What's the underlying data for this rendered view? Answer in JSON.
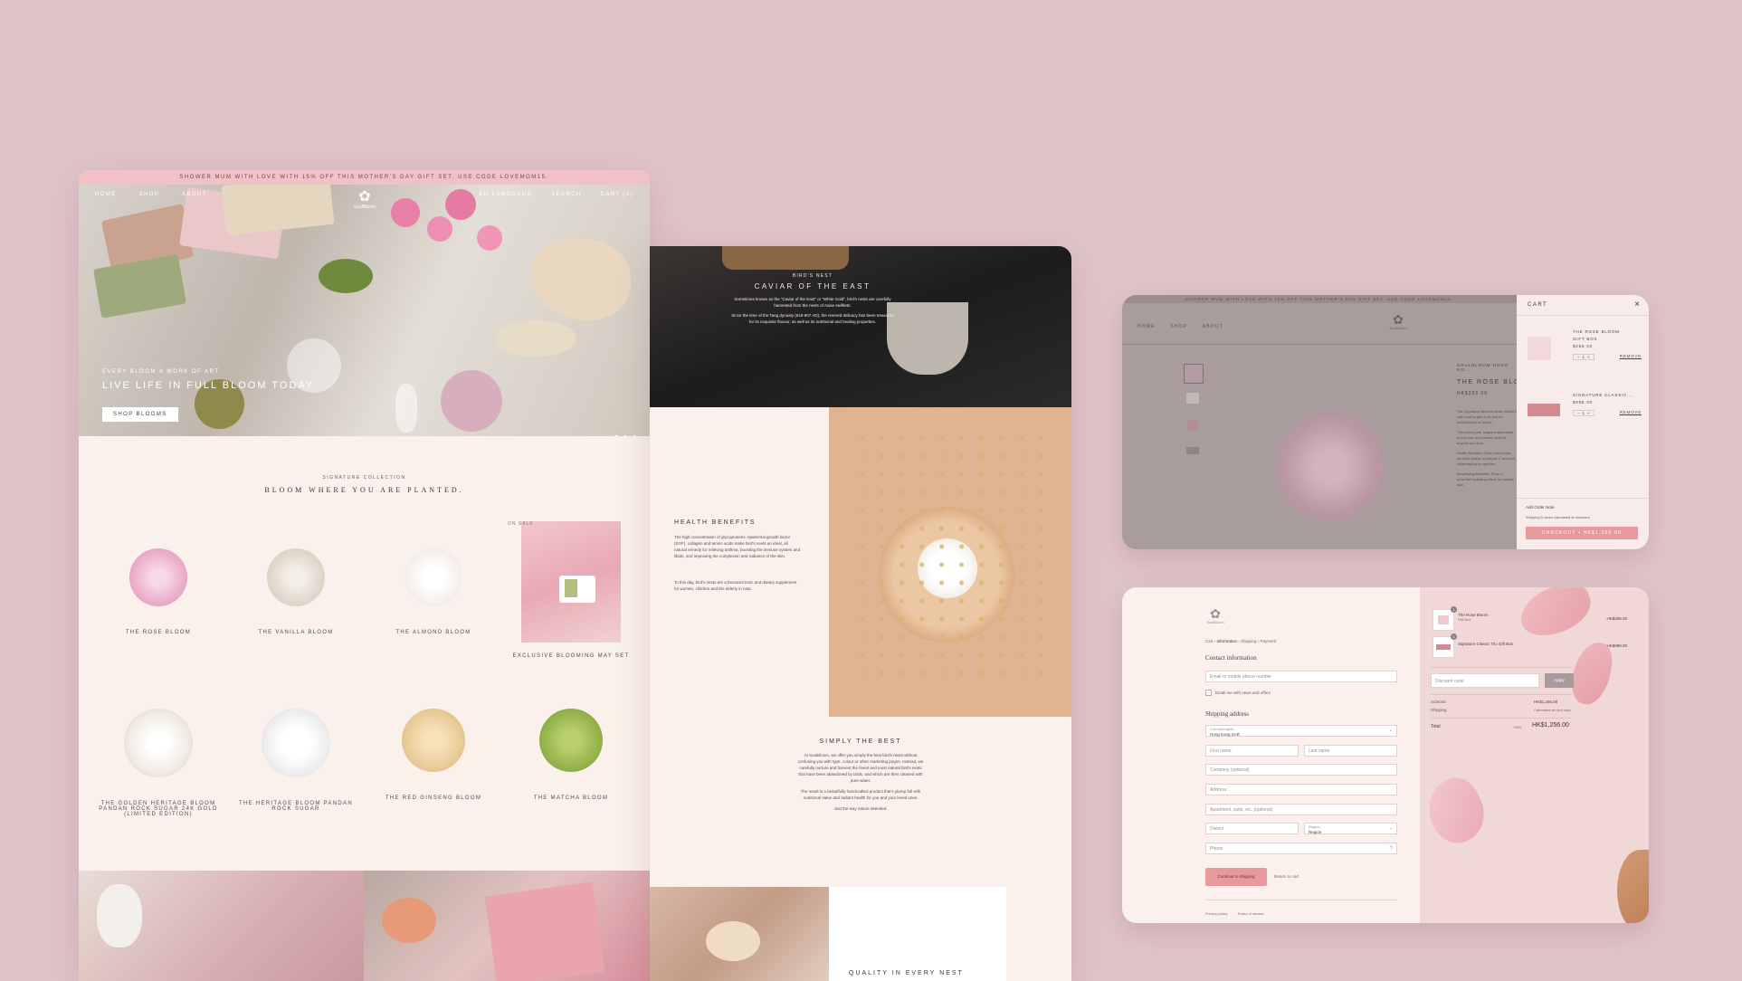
{
  "home": {
    "announcement": "SHOWER MUM WITH LOVE WITH 15% OFF THIS MOTHER'S DAY GIFT SET. USE CODE LOVEMOM15.",
    "nav": [
      "HOME",
      "SHOP",
      "ABOUT"
    ],
    "nav_right": [
      "EN LANGUAGE",
      "SEARCH",
      "CART (0)"
    ],
    "logo": "SoulBloom",
    "hero_eyebrow": "EVERY BLOOM A WORK OF ART",
    "hero_title": "LIVE LIFE IN FULL BLOOM TODAY.",
    "hero_button": "SHOP BLOOMS",
    "collection_eyebrow": "SIGNATURE COLLECTION",
    "collection_title": "BLOOM WHERE YOU ARE PLANTED.",
    "sale_badge": "ON SALE",
    "products_row1": [
      "THE ROSE BLOOM",
      "THE VANILLA BLOOM",
      "THE ALMOND BLOOM",
      "EXCLUSIVE BLOOMING MAY SET"
    ],
    "products_row2": [
      "THE GOLDEN HERITAGE BLOOM PANDAN ROCK SUGAR 24K GOLD (LIMITED EDITION)",
      "THE HERITAGE BLOOM PANDAN ROCK SUGAR",
      "THE RED GINSENG BLOOM",
      "THE MATCHA BLOOM"
    ]
  },
  "about": {
    "eyebrow": "BIRD'S NEST",
    "title": "CAVIAR OF THE EAST",
    "intro1": "Sometimes known as the \"Caviar of the East\" or \"White Gold\", bird's nests are carefully harvested from the nests of Asian swiftlets.",
    "intro2": "Since the time of the Tang dynasty (618-907 AD), the revered delicacy has been treasured for its exquisite flavour, as well as its nutritional and healing properties.",
    "benefits_title": "HEALTH BENEFITS",
    "benefits_text1": "The high concentration of glycoproteins, epidermal growth factor (EGF), collagen and amino acids make bird's nests an ideal, all natural remedy for relieving asthma, boosting the immune system and libido, and improving the complexion and radiance of the skin.",
    "benefits_text2": "To this day, bird's nests are a favoured tonic and dietary supplement for women, children and the elderly in Asia.",
    "best_title": "SIMPLY THE BEST",
    "best_text1": "At SoulBloom, we offer you simply the best bird's nests without confusing you with type, colour or other marketing jargon. Instead, we carefully nurture and harvest the finest and most natural bird's nests that have been abandoned by birds, and which are then cleaned with pure water.",
    "best_text2": "The result is a beautifully handcrafted product that's plump full with nutritional value and radiant health for you and your loved ones.",
    "best_text3": "Just the way nature intended.",
    "quality_title": "QUALITY IN EVERY NEST"
  },
  "product": {
    "announcement": "SHOWER MUM WITH LOVE WITH 15% OFF THIS MOTHER'S DAY GIFT SET. USE CODE LOVEMOM15.",
    "nav": [
      "HOME",
      "SHOP",
      "ABOUT"
    ],
    "logo": "SoulBloom",
    "brand_eyebrow": "SOULBLOOM HONG KO...",
    "title": "THE ROSE BLOOM",
    "price": "HK$258.00",
    "desc1": "The Signature almond cream infused with rose to give a lift and an embodiment of bloom.",
    "desc2": "This blush pink, fragrant alternative to the rose is a perfect treat for anyone you love.",
    "desc3": "Health Benefits: Rose extract has benefits similar to vitamin C and anti-inflammatory properties.",
    "desc4": "Beautifying Benefits: Rose is powerful hydrating effect for radiant skin."
  },
  "cart": {
    "title": "CART",
    "close": "×",
    "items": [
      {
        "name": "THE ROSE BLOOM",
        "variant": "GIFT BOX",
        "price": "$258.00",
        "qty": "1",
        "remove": "REMOVE"
      },
      {
        "name": "SIGNATURE CLASSIC ...",
        "variant": "",
        "price": "$988.00",
        "qty": "1",
        "remove": "REMOVE"
      }
    ],
    "order_note": "Add Order Note",
    "shipping_note": "Shipping & taxes calculated at checkout",
    "checkout": "CHECKOUT • HK$1,256.00"
  },
  "checkout": {
    "logo": "SoulBloom",
    "breadcrumb": [
      "Cart",
      "Information",
      "Shipping",
      "Payment"
    ],
    "contact_title": "Contact information",
    "email_placeholder": "Email or mobile phone number",
    "email_offers": "Email me with news and offers",
    "shipping_title": "Shipping address",
    "country_label": "Country/region",
    "country_value": "Hong Kong SAR",
    "first_name": "First name",
    "last_name": "Last name",
    "company": "Company (optional)",
    "address": "Address",
    "apartment": "Apartment, suite, etc. (optional)",
    "district": "District",
    "region_label": "Region",
    "region_value": "Region",
    "phone": "Phone",
    "continue_button": "Continue to shipping",
    "return_link": "Return to cart",
    "footer_links": [
      "Privacy policy",
      "Terms of service"
    ],
    "summary_items": [
      {
        "name": "The Rose Bloom",
        "variant": "Gift Box",
        "price": "HK$258.00",
        "qty": "1"
      },
      {
        "name": "Signature Classic Trio Gift Box",
        "variant": "",
        "price": "HK$988.00",
        "qty": "1"
      }
    ],
    "discount_placeholder": "Discount code",
    "apply": "Apply",
    "subtotal_label": "Subtotal",
    "subtotal_value": "HK$1,256.00",
    "shipping_label": "Shipping",
    "shipping_value": "Calculated at next step",
    "total_label": "Total",
    "total_currency": "HKD",
    "total_value": "HK$1,256.00"
  },
  "colors": {
    "background": "#dfc4c9",
    "accent": "#f2c1c5",
    "cream": "#faf0ec",
    "checkout_button": "#e8999b"
  }
}
